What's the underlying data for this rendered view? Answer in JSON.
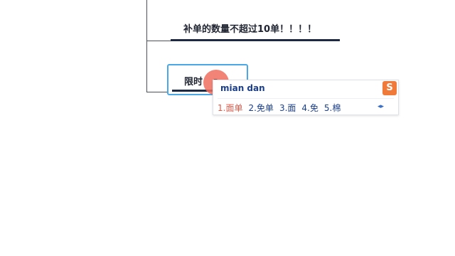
{
  "mindmap": {
    "node1_text": "补单的数量不超过10单！！！！",
    "node2_text": "限时"
  },
  "ime": {
    "pinyin": "mian dan",
    "logo": "S",
    "candidates": [
      {
        "index": "1.",
        "word": "面单"
      },
      {
        "index": "2.",
        "word": "免单"
      },
      {
        "index": "3.",
        "word": "面"
      },
      {
        "index": "4.",
        "word": "免"
      },
      {
        "index": "5.",
        "word": "棉"
      }
    ],
    "pager_prev": "◂",
    "pager_next": "▸"
  },
  "colors": {
    "ime_selected": "#e05a4a",
    "ime_text": "#1a3e8c",
    "node_border_active": "#4aa8e8",
    "ime_logo_bg": "#f07a3a"
  }
}
